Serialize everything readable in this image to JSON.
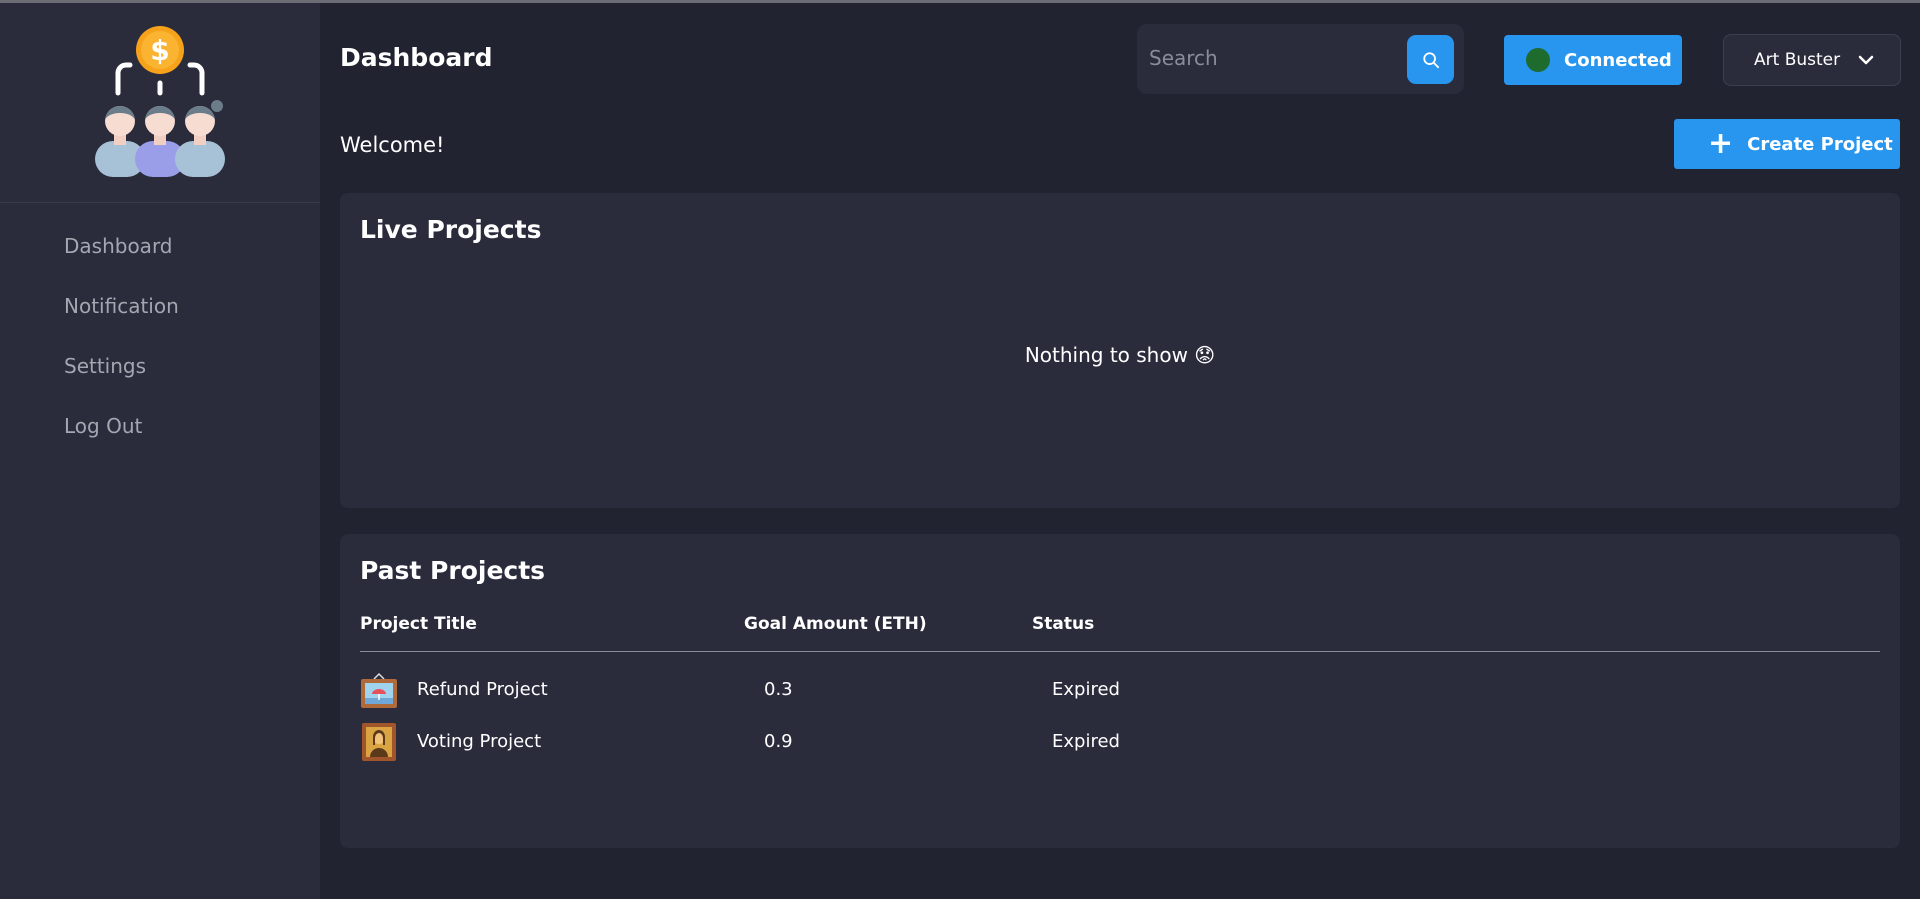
{
  "sidebar": {
    "logo_icon": "crowdfunding-team-icon",
    "items": [
      {
        "label": "Dashboard"
      },
      {
        "label": "Notification"
      },
      {
        "label": "Settings"
      },
      {
        "label": "Log Out"
      }
    ]
  },
  "header": {
    "title": "Dashboard",
    "search": {
      "placeholder": "Search",
      "value": "",
      "icon": "search-icon"
    },
    "wallet": {
      "label": "Connected",
      "status_color": "#1e6b2e"
    },
    "user": {
      "name": "Art Buster",
      "icon": "chevron-down-icon"
    }
  },
  "welcome": "Welcome!",
  "create_button": {
    "label": "Create Project",
    "icon": "plus-icon"
  },
  "live_projects": {
    "title": "Live Projects",
    "empty_message": "Nothing to show 😟"
  },
  "past_projects": {
    "title": "Past Projects",
    "columns": [
      "Project Title",
      "Goal Amount (ETH)",
      "Status"
    ],
    "rows": [
      {
        "title": "Refund Project",
        "goal": "0.3",
        "status": "Expired",
        "thumb": "framed-landscape-icon"
      },
      {
        "title": "Voting Project",
        "goal": "0.9",
        "status": "Expired",
        "thumb": "framed-portrait-icon"
      }
    ]
  },
  "colors": {
    "accent": "#2896ef",
    "background": "#212331",
    "panel": "#2a2c3c"
  }
}
